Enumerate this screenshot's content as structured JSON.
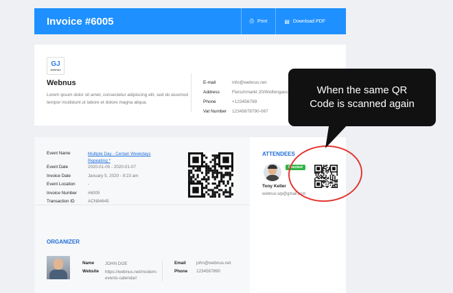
{
  "header": {
    "title": "Invoice #6005",
    "print_label": "Print",
    "download_label": "Download PDF"
  },
  "company": {
    "logo_text": "webnus",
    "name": "Webnus",
    "description": "Lorem ipsum dolor sit amet, consectetur adipiscing elit, sed do eiusmod tempor incididunt ut labore et dolore magna aliqua.",
    "contacts": [
      {
        "label": "E-mail",
        "value": "info@webnus.net"
      },
      {
        "label": "Address",
        "value": "Fleischmarkt 20/Wolfengasse"
      },
      {
        "label": "Phone",
        "value": "+123456789"
      },
      {
        "label": "Vat Number",
        "value": "12345678790-087"
      }
    ]
  },
  "event": {
    "rows": [
      {
        "label": "Event Name",
        "value": "Multiple Day - Certain Weekdays Repeating *"
      },
      {
        "label": "Event Date",
        "value": "2020-01-05 - 2020-01-07"
      },
      {
        "label": "Invoice Date",
        "value": "January 5, 2020 - 9:23 am"
      },
      {
        "label": "Event Location",
        "value": "-"
      },
      {
        "label": "Invoice Number",
        "value": "#6005"
      },
      {
        "label": "Transaction ID",
        "value": "ACN84645"
      }
    ]
  },
  "organizer": {
    "title": "ORGANIZER",
    "name_label": "Name",
    "name": "JOHN DOE",
    "website_label": "Website",
    "website": "https://webnus.net/modern-events-calendar/",
    "email_label": "Email",
    "email": "john@webnus.net",
    "phone_label": "Phone",
    "phone": "1234567890"
  },
  "attendees": {
    "title": "ATTENDEES",
    "badge": "Checked",
    "name": "Tony Keller",
    "email": "webnus.wp@gmail.com"
  },
  "callout": {
    "line1": "When the same QR",
    "line2": "Code is scanned again"
  },
  "colors": {
    "accent": "#1e90ff",
    "checked": "#2fb344",
    "circle": "#e3342f",
    "bubble": "#111111"
  }
}
